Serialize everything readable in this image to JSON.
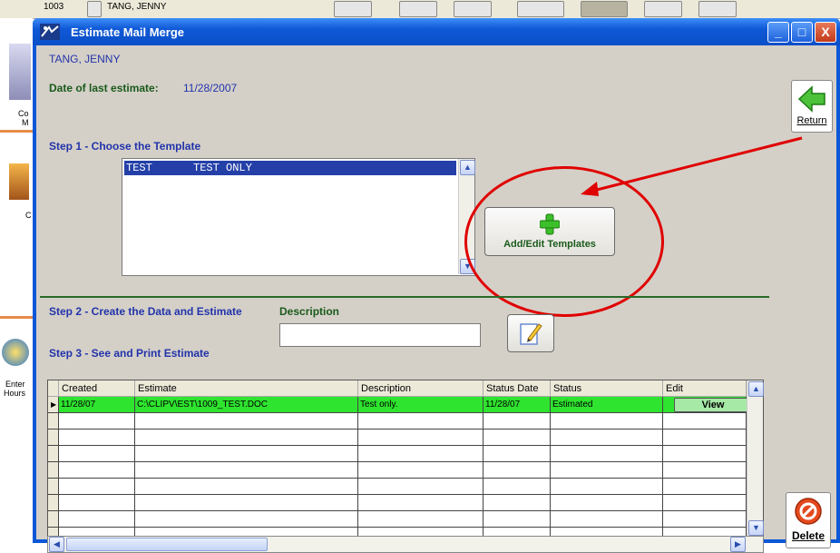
{
  "background_app": {
    "top_fields": [
      "1003",
      "TANG, JENNY"
    ],
    "side_labels": [
      "Co",
      "M",
      "C",
      "Enter",
      "Hours"
    ]
  },
  "window": {
    "title": "Estimate Mail Merge",
    "title_buttons": [
      "_",
      "□",
      "X"
    ]
  },
  "client_name": "TANG, JENNY",
  "last_estimate": {
    "label": "Date of last estimate:",
    "value": "11/28/2007"
  },
  "step1": {
    "label": "Step 1 - Choose the Template",
    "templates": [
      {
        "name": "TEST",
        "description": "TEST ONLY"
      }
    ]
  },
  "add_templates": {
    "label": "Add/Edit Templates",
    "icon": "green-plus-icon"
  },
  "step2": {
    "label": "Step 2 - Create the Data and Estimate",
    "description_label": "Description",
    "description_value": ""
  },
  "step3": {
    "label": "Step 3 - See and Print Estimate"
  },
  "grid": {
    "columns": [
      "Created",
      "Estimate",
      "Description",
      "Status Date",
      "Status",
      "Edit"
    ],
    "rows": [
      {
        "created": "11/28/07",
        "estimate": "C:\\CLIPV\\EST\\1009_TEST.DOC",
        "description": "Test only.",
        "status_date": "11/28/07",
        "status": "Estimated",
        "edit": "View"
      }
    ],
    "empty_rows": 8
  },
  "return_button": {
    "label": "Return",
    "icon": "green-back-arrow-icon"
  },
  "delete_button": {
    "label": "Delete",
    "icon": "no-entry-icon"
  },
  "colors": {
    "title_blue": "#0f58d6",
    "selected_row": "#2fe42f",
    "annotation_red": "#e00000"
  }
}
